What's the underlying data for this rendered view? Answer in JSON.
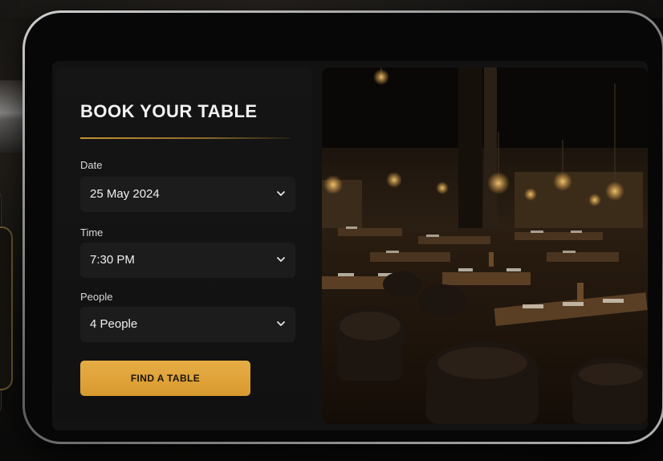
{
  "booking": {
    "title": "BOOK YOUR TABLE",
    "date": {
      "label": "Date",
      "value": "25 May 2024"
    },
    "time": {
      "label": "Time",
      "value": "7:30 PM"
    },
    "people": {
      "label": "People",
      "value": "4 People"
    },
    "submit_label": "FIND A TABLE"
  },
  "theme": {
    "accent": "#E3A840",
    "panel": "#151515",
    "field": "#1C1C1C"
  },
  "icons": {
    "dropdown": "chevron-down-icon"
  }
}
